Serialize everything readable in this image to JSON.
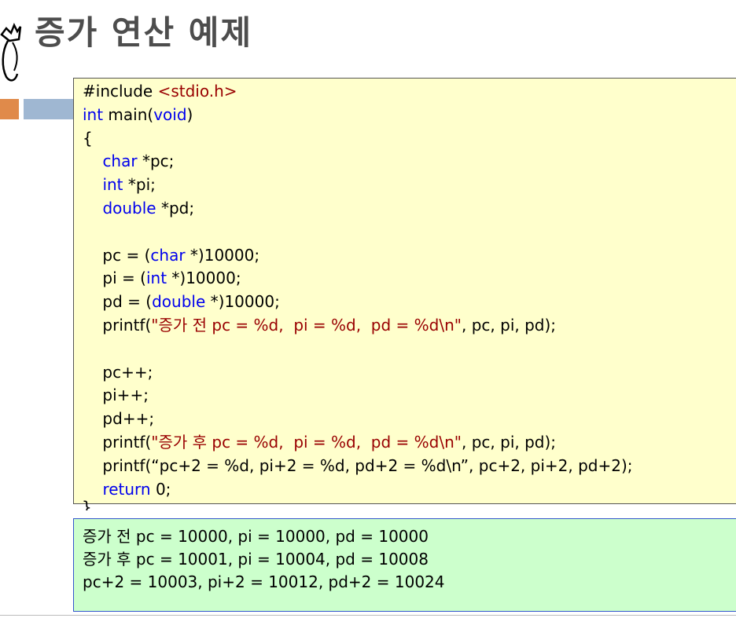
{
  "slide": {
    "title": "증가 연산 예제",
    "accent_colors": {
      "orange": "#e08a4a",
      "blue": "#9fb7d2"
    }
  },
  "code": {
    "background": "#ffffcc",
    "keyword_color": "#0000ee",
    "string_color": "#990000",
    "lines": [
      [
        {
          "t": "#include "
        },
        {
          "t": "<stdio.h>",
          "c": "str"
        }
      ],
      [
        {
          "t": "int",
          "c": "kw"
        },
        {
          "t": " main("
        },
        {
          "t": "void",
          "c": "kw"
        },
        {
          "t": ")"
        }
      ],
      [
        {
          "t": "{"
        }
      ],
      [
        {
          "t": "    "
        },
        {
          "t": "char",
          "c": "kw"
        },
        {
          "t": " *pc;"
        }
      ],
      [
        {
          "t": "    "
        },
        {
          "t": "int",
          "c": "kw"
        },
        {
          "t": " *pi;"
        }
      ],
      [
        {
          "t": "    "
        },
        {
          "t": "double",
          "c": "kw"
        },
        {
          "t": " *pd;"
        }
      ],
      [
        {
          "t": ""
        }
      ],
      [
        {
          "t": "    pc = ("
        },
        {
          "t": "char",
          "c": "kw"
        },
        {
          "t": " *)10000;"
        }
      ],
      [
        {
          "t": "    pi = ("
        },
        {
          "t": "int",
          "c": "kw"
        },
        {
          "t": " *)10000;"
        }
      ],
      [
        {
          "t": "    pd = ("
        },
        {
          "t": "double",
          "c": "kw"
        },
        {
          "t": " *)10000;"
        }
      ],
      [
        {
          "t": "    printf("
        },
        {
          "t": "\"증가 전 pc = %d,  pi = %d,  pd = %d\\n\"",
          "c": "str"
        },
        {
          "t": ", pc, pi, pd);"
        }
      ],
      [
        {
          "t": ""
        }
      ],
      [
        {
          "t": "    pc++;"
        }
      ],
      [
        {
          "t": "    pi++;"
        }
      ],
      [
        {
          "t": "    pd++;"
        }
      ],
      [
        {
          "t": "    printf("
        },
        {
          "t": "\"증가 후 pc = %d,  pi = %d,  pd = %d\\n\"",
          "c": "str"
        },
        {
          "t": ", pc, pi, pd);"
        }
      ],
      [
        {
          "t": "    printf(“pc+2 = %d, pi+2 = %d, pd+2 = %d\\n”, pc+2, pi+2, pd+2);"
        }
      ],
      [
        {
          "t": "    "
        },
        {
          "t": "return",
          "c": "kw"
        },
        {
          "t": " 0;"
        }
      ]
    ],
    "closing_brace": "}"
  },
  "output": {
    "background": "#ccffcc",
    "lines": [
      "증가 전 pc = 10000, pi = 10000, pd = 10000",
      "증가 후 pc = 10001, pi = 10004, pd = 10008",
      "pc+2 = 10003, pi+2 = 10012, pd+2 = 10024"
    ]
  }
}
